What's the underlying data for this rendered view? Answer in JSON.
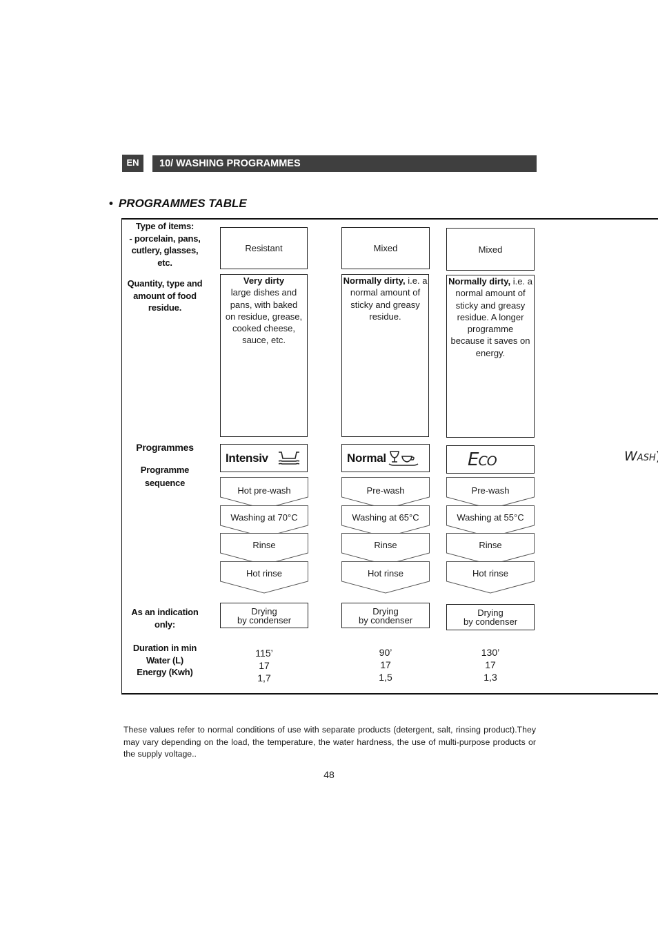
{
  "header": {
    "language_badge": "EN",
    "section_title": "10/ WASHING PROGRAMMES"
  },
  "table_title": {
    "bullet": "•",
    "text": "PROGRAMMES TABLE"
  },
  "row_labels": {
    "type_of_items": [
      "Type of items:",
      "- porcelain, pans,",
      "cutlery, glasses,",
      "etc."
    ],
    "quantity": [
      "Quantity, type and",
      "amount of food",
      "residue."
    ],
    "programmes": "Programmes",
    "sequence": [
      "Programme",
      "sequence"
    ],
    "indication": [
      "As an indication",
      "only:"
    ],
    "metrics": [
      "Duration in min",
      "Water (L)",
      "Energy (Kwh)"
    ]
  },
  "programmes": [
    {
      "type": "Resistant",
      "desc_bold": "Very dirty",
      "desc_lines": [
        "large dishes and",
        "pans, with baked",
        "on residue, grease,",
        "cooked cheese,",
        "sauce, etc."
      ],
      "name": "Intensiv",
      "icon": "pot-pan-icon",
      "steps": [
        "Hot pre-wash",
        "Washing at 70°C",
        "Rinse",
        "Hot rinse"
      ],
      "drying": [
        "Drying",
        "by condenser"
      ],
      "duration": "115’",
      "water": "17",
      "energy": "1,7"
    },
    {
      "type": "Mixed",
      "desc_bold": "Normally dirty,",
      "desc_rest_first": " i.e. a",
      "desc_lines": [
        "normal amount of",
        "sticky and greasy",
        "residue."
      ],
      "name": "Normal",
      "icon": "glass-and-cup-icon",
      "steps": [
        "Pre-wash",
        "Washing at 65°C",
        "Rinse",
        "Hot rinse"
      ],
      "drying": [
        "Drying",
        "by condenser"
      ],
      "duration": "90’",
      "water": "17",
      "energy": "1,5"
    },
    {
      "type": "Mixed",
      "desc_bold": "Normally dirty,",
      "desc_rest_first": " i.e. a",
      "desc_lines": [
        "normal amount of",
        "sticky and greasy",
        "residue. A longer",
        "programme",
        "because it saves on",
        "energy."
      ],
      "name_logo_big": "E",
      "name_logo_small": "CO",
      "steps": [
        "Pre-wash",
        "Washing at 55°C",
        "Rinse",
        "Hot rinse"
      ],
      "drying": [
        "Drying",
        "by condenser"
      ],
      "duration": "130’",
      "water": "17",
      "energy": "1,3"
    }
  ],
  "wash_logo": {
    "big": "W",
    "small": "ASH",
    "tail": ")"
  },
  "footnote": "These values refer to normal conditions of use with separate products (detergent, salt, rinsing product).They may vary depending on the load, the temperature, the water hardness, the use of multi-purpose products or the supply voltage..",
  "page_number": "48"
}
